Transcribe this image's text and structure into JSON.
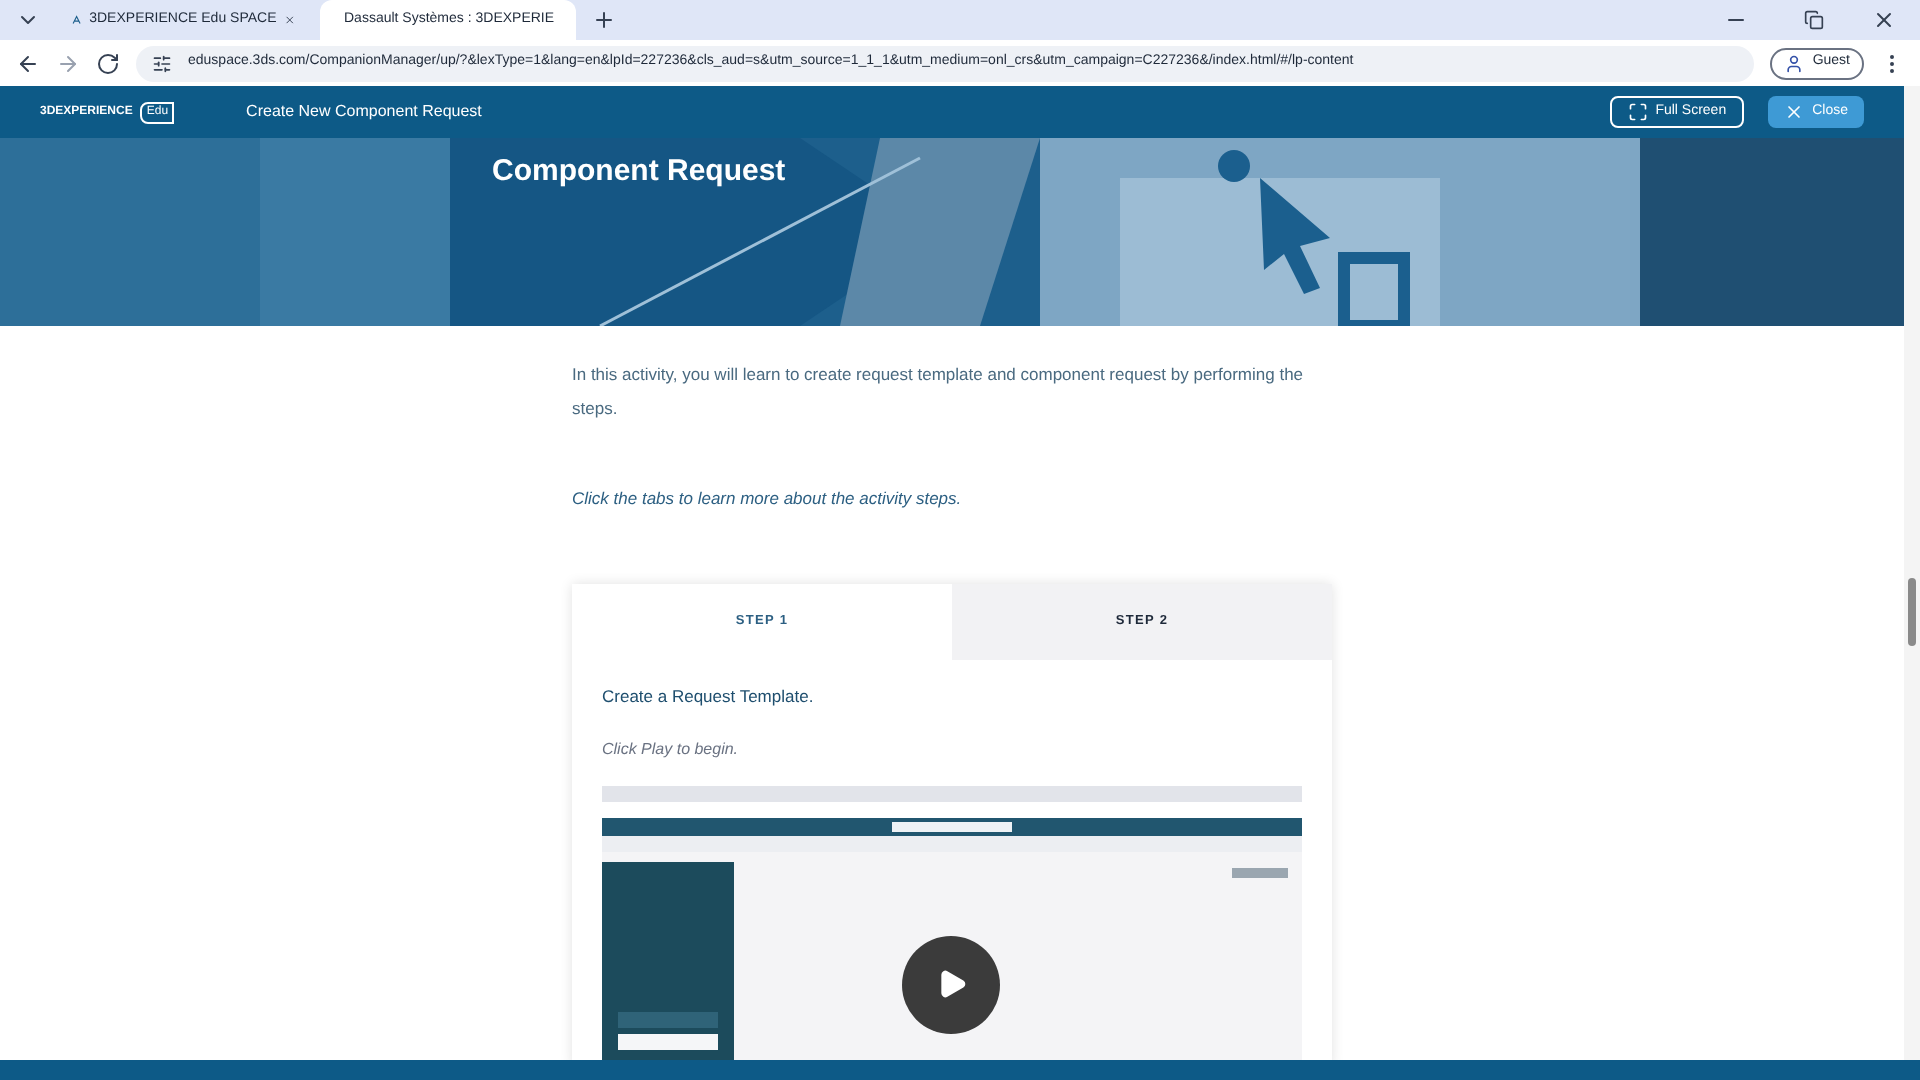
{
  "browser": {
    "tabs": [
      {
        "title": "3DEXPERIENCE Edu SPACE",
        "selected": false
      },
      {
        "title": "Dassault Systèmes : 3DEXPERIE",
        "selected": true
      }
    ],
    "url": "eduspace.3ds.com/CompanionManager/up/?&lexType=1&lang=en&lpId=227236&cls_aud=s&utm_source=1_1_1&utm_medium=onl_crs&utm_campaign=C227236&/index.html/#/lp-content",
    "profile": "Guest"
  },
  "header": {
    "logo_text": "3DEXPERIENCE",
    "logo_badge": "Edu",
    "title": "Create New Component Request",
    "buttons": [
      {
        "label": "Full Screen",
        "kind": "outline"
      },
      {
        "label": "Close",
        "kind": "filled"
      }
    ]
  },
  "banner": {
    "title": "Component Request"
  },
  "intro": "In this activity, you will learn to create request template and component request by performing the steps.",
  "hint": "Click the tabs to learn more about the activity steps.",
  "steps": {
    "tabs": [
      {
        "label": "STEP 1",
        "selected": true
      },
      {
        "label": "STEP 2",
        "selected": false
      }
    ],
    "heading": "Create a Request Template.",
    "instruction": "Click Play to begin."
  }
}
